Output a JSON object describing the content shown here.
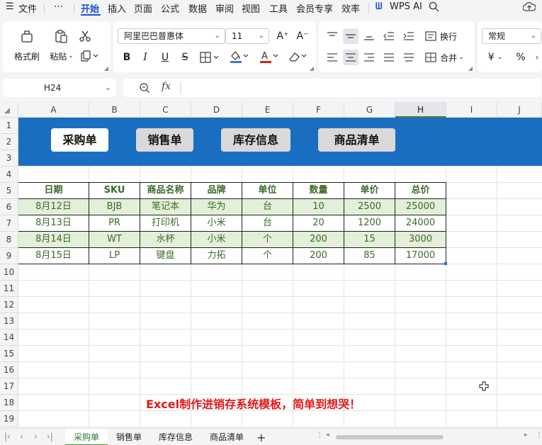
{
  "menu": {
    "file": "文件",
    "more": "⋯",
    "tabs": [
      "开始",
      "插入",
      "页面",
      "公式",
      "数据",
      "审阅",
      "视图",
      "工具",
      "会员专享",
      "效率"
    ],
    "wps_ai": "WPS AI"
  },
  "ribbon": {
    "format_painter": "格式刷",
    "paste": "粘贴",
    "font_name": "阿里巴巴普惠体",
    "font_size": "11",
    "wrap": "换行",
    "merge": "合并",
    "number_format": "常规",
    "bold": "B",
    "italic": "I",
    "underline": "U",
    "strike": "S",
    "font_color_letter": "A",
    "percent": "%",
    "currency": "¥",
    "grow_font": "A⁺",
    "shrink_font": "A⁻"
  },
  "formula_bar": {
    "cell_ref": "H24",
    "fx": "fx",
    "content": ""
  },
  "grid": {
    "columns": [
      "A",
      "B",
      "C",
      "D",
      "E",
      "F",
      "G",
      "H",
      "I",
      "J"
    ],
    "selected_column": "H",
    "rows": [
      "1",
      "2",
      "3",
      "4",
      "5",
      "6",
      "7",
      "8",
      "9",
      "10",
      "11",
      "12",
      "13",
      "14",
      "15",
      "16",
      "17",
      "18",
      "19"
    ]
  },
  "nav_buttons": [
    {
      "label": "采购单",
      "active": true
    },
    {
      "label": "销售单",
      "active": false
    },
    {
      "label": "库存信息",
      "active": false
    },
    {
      "label": "商品清单",
      "active": false
    }
  ],
  "table": {
    "headers": [
      "日期",
      "SKU",
      "商品名称",
      "品牌",
      "单位",
      "数量",
      "单价",
      "总价"
    ],
    "rows": [
      [
        "8月12日",
        "BJB",
        "笔记本",
        "华为",
        "台",
        "10",
        "2500",
        "25000"
      ],
      [
        "8月13日",
        "PR",
        "打印机",
        "小米",
        "台",
        "20",
        "1200",
        "24000"
      ],
      [
        "8月14日",
        "WT",
        "水杯",
        "小米",
        "个",
        "200",
        "15",
        "3000"
      ],
      [
        "8月15日",
        "LP",
        "键盘",
        "力拓",
        "个",
        "200",
        "85",
        "17000"
      ]
    ]
  },
  "caption": "Excel制作进销存系统模板，简单到想哭！",
  "sheet_tabs": [
    "采购单",
    "销售单",
    "库存信息",
    "商品清单"
  ],
  "active_sheet": "采购单",
  "colors": {
    "accent": "#1a4fd6",
    "banner": "#1a6ec2",
    "table_text": "#3a6b2a",
    "row_fill": "#e3efd9",
    "caption": "#e01b1b"
  }
}
